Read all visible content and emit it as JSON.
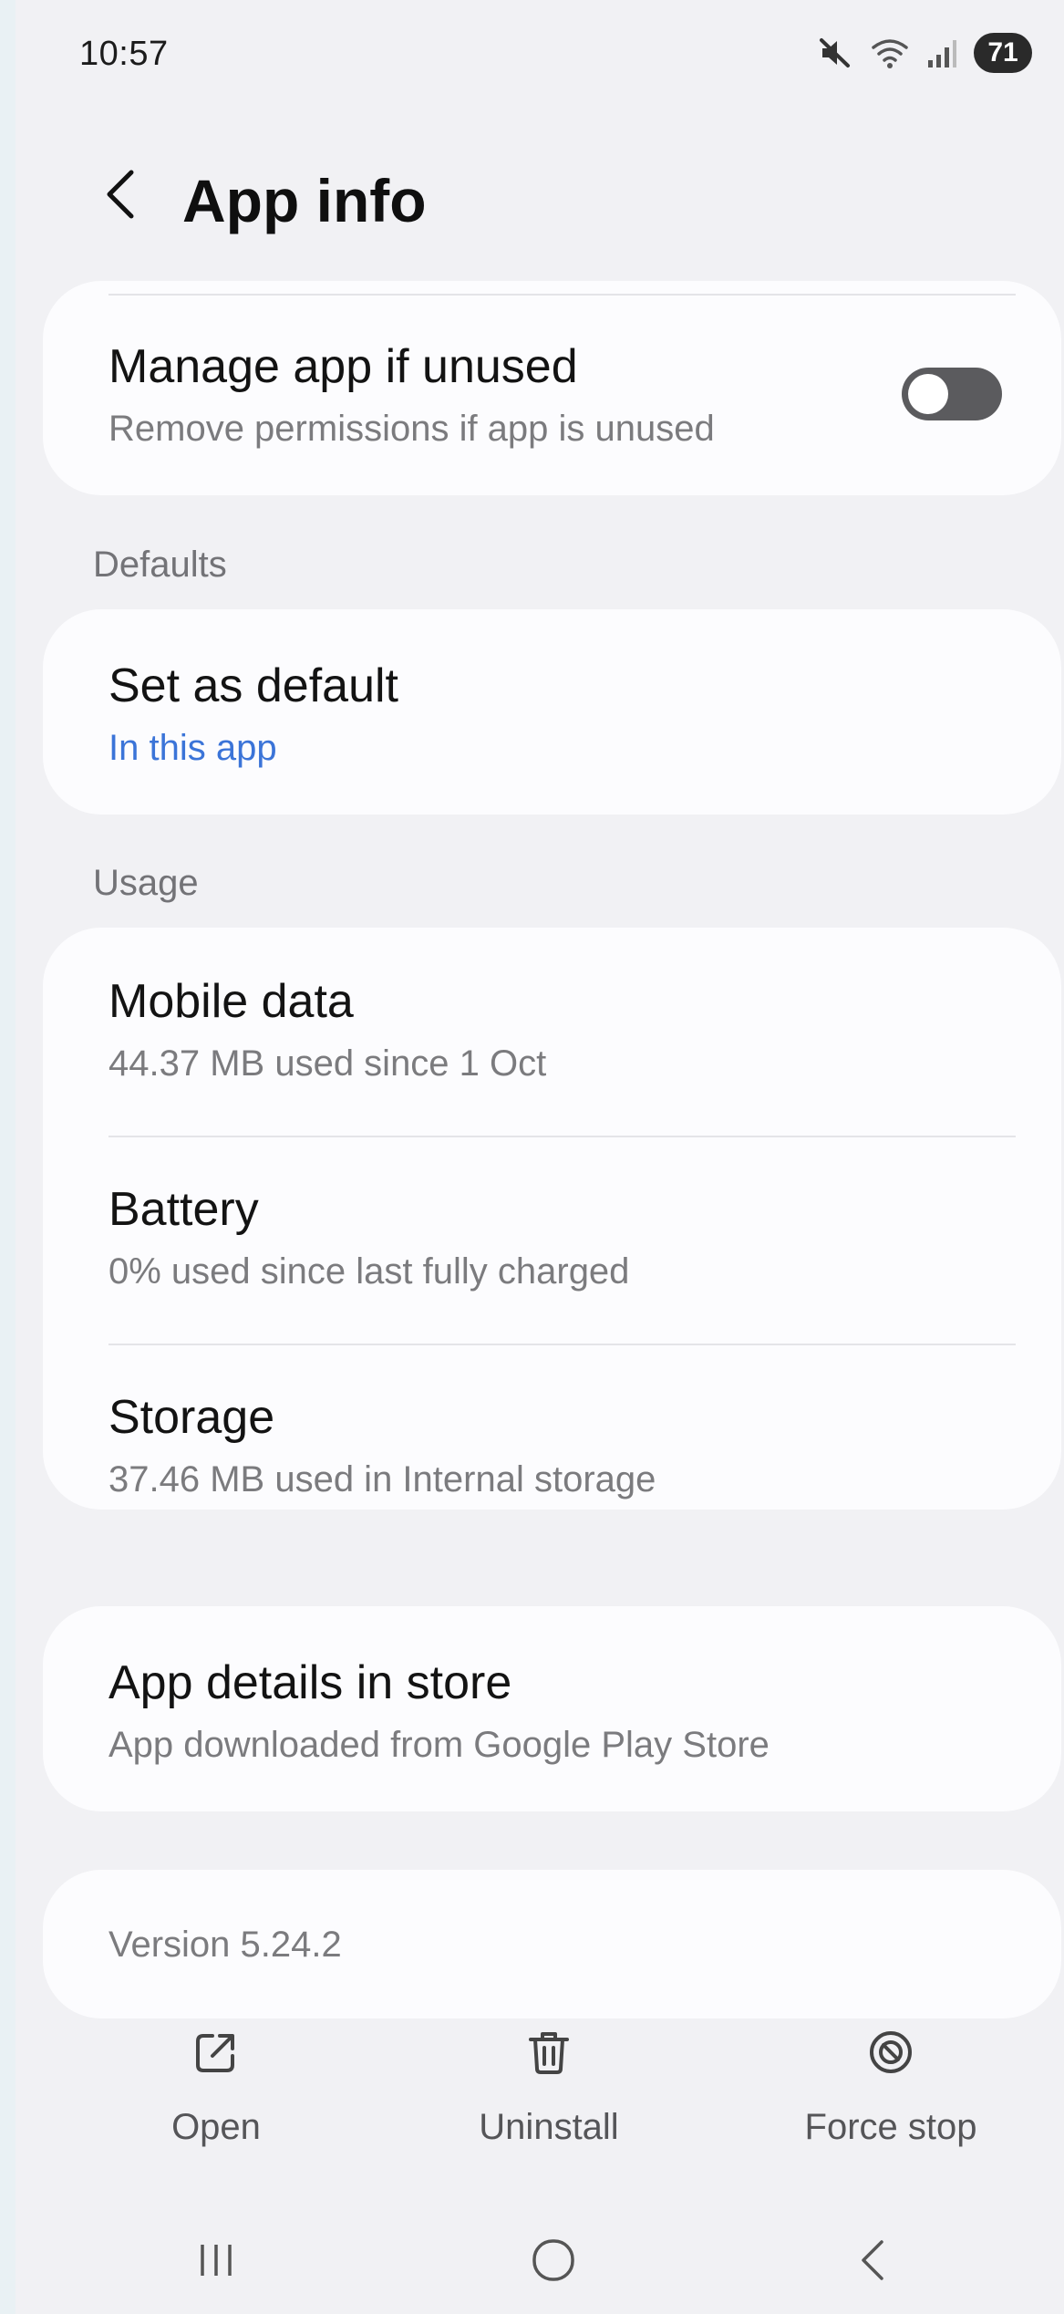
{
  "status_bar": {
    "time": "10:57",
    "battery_level": "71",
    "icons": [
      "mute-icon",
      "wifi-icon",
      "signal-icon",
      "battery-icon"
    ]
  },
  "header": {
    "title": "App info",
    "back_icon": "chevron-left-icon"
  },
  "manage_unused": {
    "title": "Manage app if unused",
    "subtitle": "Remove permissions if app is unused",
    "toggle_on": false
  },
  "defaults": {
    "section_label": "Defaults",
    "set_default": {
      "title": "Set as default",
      "subtitle": "In this app"
    }
  },
  "usage": {
    "section_label": "Usage",
    "items": [
      {
        "title": "Mobile data",
        "subtitle": "44.37 MB used since 1 Oct"
      },
      {
        "title": "Battery",
        "subtitle": "0% used since last fully charged"
      },
      {
        "title": "Storage",
        "subtitle": "37.46 MB used in Internal storage"
      }
    ]
  },
  "store": {
    "title": "App details in store",
    "subtitle": "App downloaded from Google Play Store"
  },
  "version": {
    "text": "Version 5.24.2"
  },
  "actions": [
    {
      "label": "Open",
      "icon": "open-external-icon"
    },
    {
      "label": "Uninstall",
      "icon": "trash-icon"
    },
    {
      "label": "Force stop",
      "icon": "force-stop-icon"
    }
  ],
  "nav": {
    "icons": [
      "recent-apps-icon",
      "home-icon",
      "back-icon"
    ]
  },
  "colors": {
    "background": "#f1f1f4",
    "card": "#fcfcfe",
    "link": "#3b74d8",
    "toggle_off": "#5b5b5e"
  }
}
